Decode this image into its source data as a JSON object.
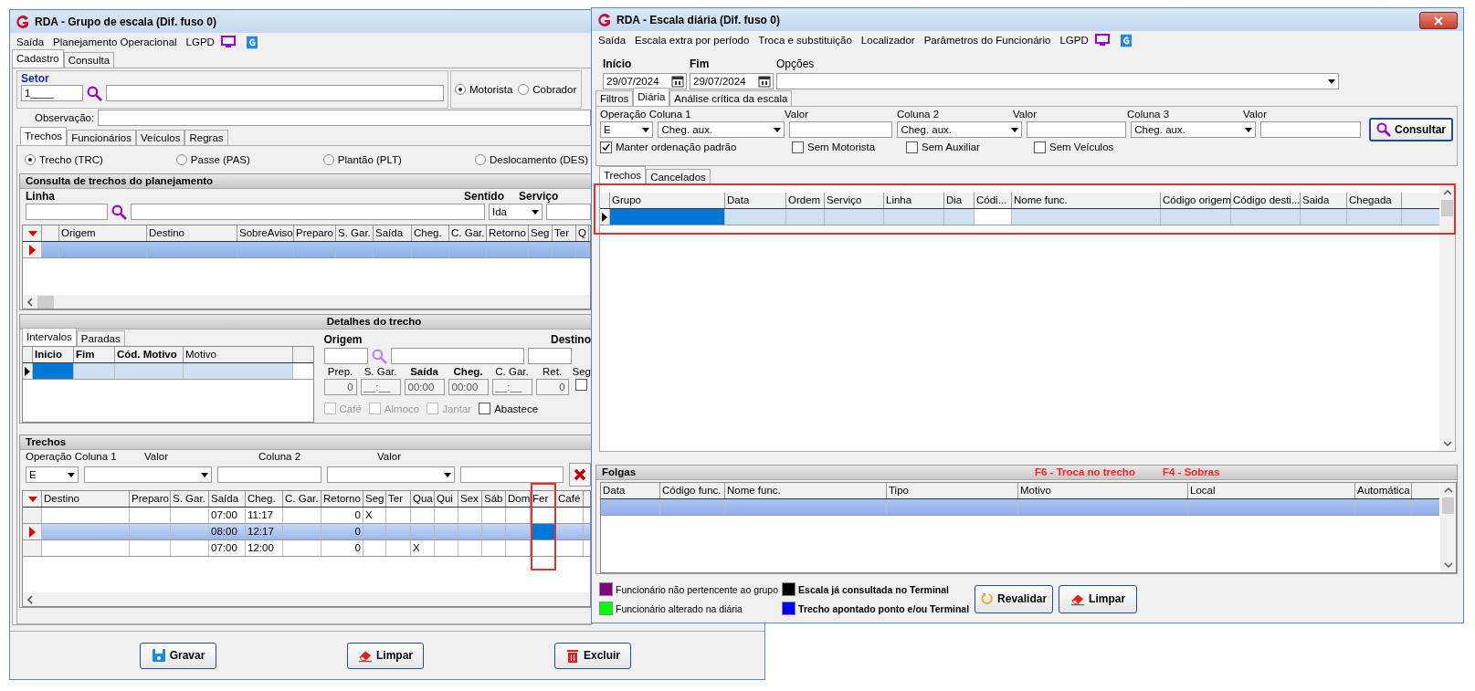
{
  "left_window": {
    "title": "RDA - Grupo de escala (Dif. fuso 0)",
    "menu": [
      "Saída",
      "Planejamento Operacional",
      "LGPD"
    ],
    "tabs": [
      {
        "label": "Cadastro",
        "selected": true
      },
      {
        "label": "Consulta",
        "selected": false
      }
    ],
    "setor": {
      "label": "Setor",
      "code": "1____"
    },
    "roles": [
      {
        "label": "Motorista",
        "selected": true
      },
      {
        "label": "Cobrador",
        "selected": false
      }
    ],
    "observacao_label": "Observação:",
    "sub_tabs": [
      {
        "label": "Trechos",
        "selected": true
      },
      {
        "label": "Funcionários",
        "selected": false
      },
      {
        "label": "Veículos",
        "selected": false
      },
      {
        "label": "Regras",
        "selected": false
      }
    ],
    "trecho_types": [
      {
        "label": "Trecho (TRC)",
        "selected": true
      },
      {
        "label": "Passe (PAS)",
        "selected": false
      },
      {
        "label": "Plantão (PLT)",
        "selected": false
      },
      {
        "label": "Deslocamento (DES)",
        "selected": false
      }
    ],
    "consulta": {
      "title": "Consulta de trechos do planejamento",
      "linha_label": "Linha",
      "sentido_label": "Sentido",
      "sentido_value": "Ida",
      "servico_label": "Serviço",
      "columns": [
        "Origem",
        "Destino",
        "SobreAviso",
        "Preparo",
        "S. Gar.",
        "Saída",
        "Cheg.",
        "C. Gar.",
        "Retorno",
        "Seg",
        "Ter",
        "Q"
      ],
      "rows": [
        {
          "selected": true
        }
      ]
    },
    "detalhes": {
      "title": "Detalhes do trecho",
      "tabs": [
        {
          "label": "Intervalos",
          "selected": true
        },
        {
          "label": "Paradas",
          "selected": false
        }
      ],
      "columns": [
        {
          "label": "Inicio",
          "focused": true
        },
        {
          "label": "Fim",
          "focused": false
        },
        {
          "label": "Cód. Motivo",
          "focused": false
        },
        {
          "label": "Motivo",
          "focused": false
        }
      ],
      "origem_label": "Origem",
      "destino_label": "Destino",
      "fields": [
        {
          "label": "Prep.",
          "value": "0",
          "emphasis": false,
          "kind": "number"
        },
        {
          "label": "S. Gar.",
          "value": "__:__",
          "emphasis": false,
          "kind": "time"
        },
        {
          "label": "Saída",
          "value": "00:00",
          "emphasis": true,
          "kind": "time"
        },
        {
          "label": "Cheg.",
          "value": "00:00",
          "emphasis": true,
          "kind": "time"
        },
        {
          "label": "C. Gar.",
          "value": "__:__",
          "emphasis": false,
          "kind": "time"
        },
        {
          "label": "Ret.",
          "value": "0",
          "emphasis": false,
          "kind": "number"
        }
      ],
      "seg": {
        "label": "Seg",
        "checked": false
      },
      "options": [
        {
          "label": "Café",
          "checked": false,
          "disabled": true
        },
        {
          "label": "Almoco",
          "checked": false,
          "disabled": true
        },
        {
          "label": "Jantar",
          "checked": false,
          "disabled": true
        },
        {
          "label": "Abastece",
          "checked": false,
          "disabled": false
        }
      ]
    },
    "trechos": {
      "title": "Trechos",
      "filter_labels": [
        "Operação Coluna 1",
        "Valor",
        "Coluna 2",
        "Valor"
      ],
      "operacao": "E",
      "columns": [
        {
          "label": "Destino",
          "focused": false
        },
        {
          "label": "Preparo",
          "focused": false
        },
        {
          "label": "S. Gar.",
          "focused": false
        },
        {
          "label": "Saída",
          "focused": false
        },
        {
          "label": "Cheg.",
          "focused": false
        },
        {
          "label": "C. Gar.",
          "focused": false
        },
        {
          "label": "Retorno",
          "focused": false
        },
        {
          "label": "Seg",
          "focused": false
        },
        {
          "label": "Ter",
          "focused": false
        },
        {
          "label": "Qua",
          "focused": false
        },
        {
          "label": "Qui",
          "focused": false
        },
        {
          "label": "Sex",
          "focused": false
        },
        {
          "label": "Sáb",
          "focused": false
        },
        {
          "label": "Dom",
          "focused": false
        },
        {
          "label": "Fer",
          "focused": true
        },
        {
          "label": "Café",
          "focused": false
        }
      ],
      "rows": [
        {
          "selected": false,
          "cells": [
            null,
            null,
            null,
            "07:00",
            "11:17",
            null,
            "0",
            "X",
            null,
            null,
            null,
            null,
            null,
            null,
            null,
            null
          ]
        },
        {
          "selected": true,
          "cells": [
            null,
            null,
            null,
            "08:00",
            "12:17",
            null,
            "0",
            null,
            null,
            null,
            null,
            null,
            null,
            null,
            null,
            null
          ]
        },
        {
          "selected": false,
          "cells": [
            null,
            null,
            null,
            "07:00",
            "12:00",
            null,
            "0",
            null,
            null,
            "X",
            null,
            null,
            null,
            null,
            null,
            null
          ]
        }
      ]
    },
    "buttons": [
      {
        "label": "Gravar",
        "kind": "save"
      },
      {
        "label": "Limpar",
        "kind": "clear"
      },
      {
        "label": "Excluir",
        "kind": "delete"
      }
    ]
  },
  "right_window": {
    "title": "RDA - Escala diária (Dif. fuso 0)",
    "menu": [
      "Saída",
      "Escala extra por período",
      "Troca e substituição",
      "Localizador",
      "Parâmetros do Funcionário",
      "LGPD"
    ],
    "inicio": {
      "label": "Início",
      "value": "29/07/2024"
    },
    "fim": {
      "label": "Fim",
      "value": "29/07/2024"
    },
    "opcoes_label": "Opções",
    "tabs": [
      {
        "label": "Filtros",
        "selected": false
      },
      {
        "label": "Diária",
        "selected": true
      },
      {
        "label": "Análise crítica da escala",
        "selected": false
      }
    ],
    "filter_labels": [
      "Operação Coluna 1",
      "Valor",
      "Coluna 2",
      "Valor",
      "Coluna 3",
      "Valor"
    ],
    "operacao": "E",
    "colunas": [
      "Cheg. aux.",
      "Cheg. aux.",
      "Cheg. aux."
    ],
    "consultar": "Consultar",
    "checkboxes": [
      {
        "label": "Manter ordenação padrão",
        "checked": true
      },
      {
        "label": "Sem Motorista",
        "checked": false
      },
      {
        "label": "Sem Auxiliar",
        "checked": false
      },
      {
        "label": "Sem Veículos",
        "checked": false
      }
    ],
    "grid_tabs": [
      {
        "label": "Trechos",
        "selected": true
      },
      {
        "label": "Cancelados",
        "selected": false
      }
    ],
    "columns": [
      {
        "label": "Grupo",
        "kind": "focused"
      },
      {
        "label": "Data",
        "kind": "normal"
      },
      {
        "label": "Ordem",
        "kind": "normal"
      },
      {
        "label": "Serviço",
        "kind": "normal"
      },
      {
        "label": "Linha",
        "kind": "normal"
      },
      {
        "label": "Dia",
        "kind": "normal"
      },
      {
        "label": "Códi...",
        "kind": "plain"
      },
      {
        "label": "Nome func.",
        "kind": "normal"
      },
      {
        "label": "Código origem",
        "kind": "normal"
      },
      {
        "label": "Código desti...",
        "kind": "normal"
      },
      {
        "label": "Saida",
        "kind": "normal"
      },
      {
        "label": "Chegada",
        "kind": "normal"
      }
    ],
    "rows": [
      {
        "selected": true
      }
    ],
    "folgas": {
      "title": "Folgas",
      "hotkeys": [
        "F6 - Troca no trecho",
        "F4 - Sobras"
      ],
      "columns": [
        "Data",
        "Código func.",
        "Nome func.",
        "Tipo",
        "Motivo",
        "Local",
        "Automática"
      ],
      "rows": [
        {
          "selected": true
        }
      ]
    },
    "legend": [
      {
        "label": "Funcionário não pertencente ao grupo",
        "color": "#800080",
        "emphasis": false
      },
      {
        "label": "Funcionário alterado na diária",
        "color": "#00ff00",
        "emphasis": false
      },
      {
        "label": "Escala já consultada no Terminal",
        "color": "#000000",
        "emphasis": true
      },
      {
        "label": "Trecho apontado ponto e/ou Terminal",
        "color": "#0000ff",
        "emphasis": true
      }
    ],
    "buttons": [
      {
        "label": "Revalidar",
        "kind": "refresh"
      },
      {
        "label": "Limpar",
        "kind": "clear"
      }
    ]
  }
}
